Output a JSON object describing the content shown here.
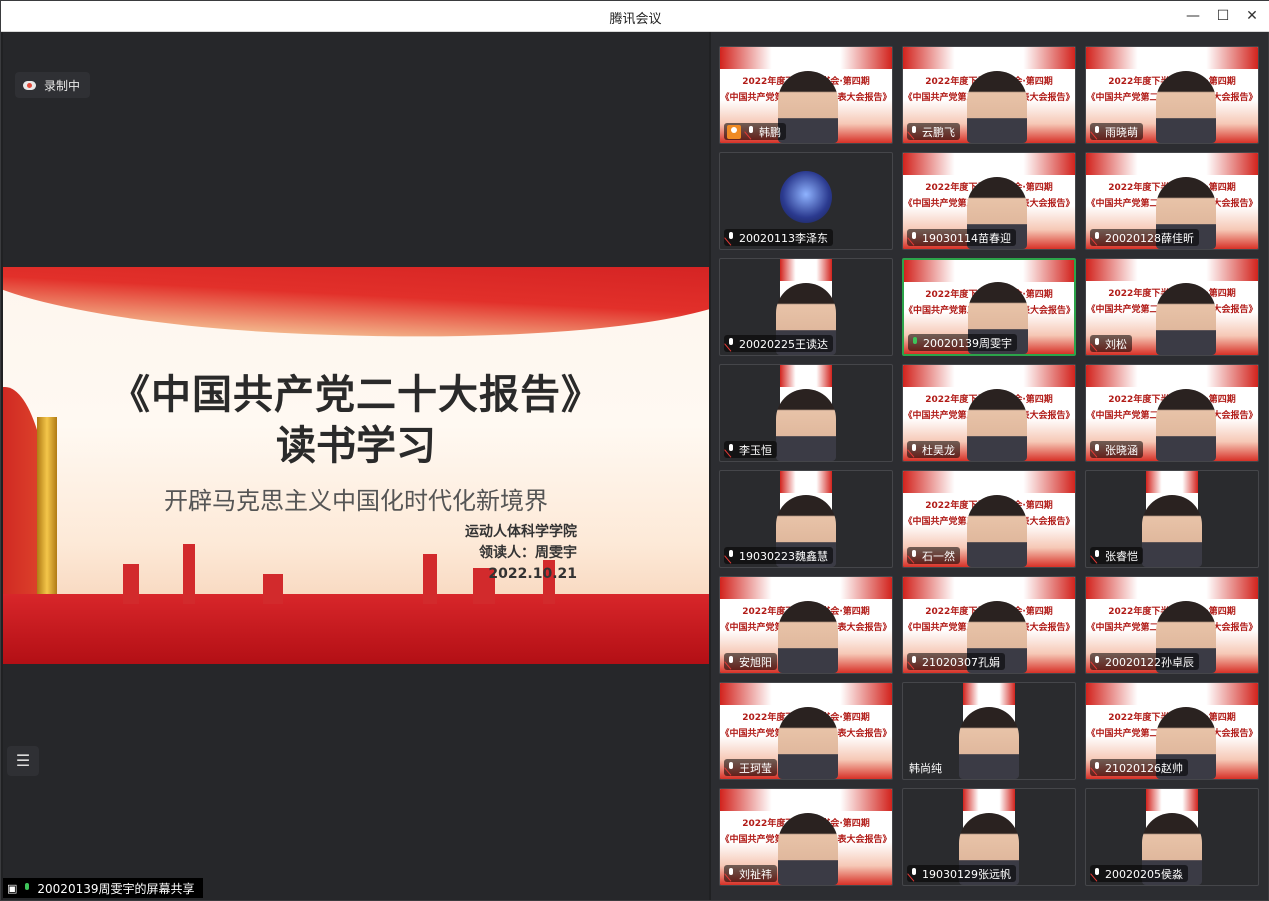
{
  "window": {
    "title": "腾讯会议",
    "minimize": "—",
    "maximize": "☐",
    "close": "✕"
  },
  "recording": {
    "label": "录制中"
  },
  "slide": {
    "title_line1": "《中国共产党二十大报告》",
    "title_line2": "读书学习",
    "subtitle": "开辟马克思主义中国化时代化新境界",
    "college": "运动人体科学学院",
    "leader": "领读人：周雯宇",
    "date": "2022.10.21"
  },
  "share_bar": {
    "label": "20020139周雯宇的屏幕共享"
  },
  "poster_text": {
    "line1": "2022年度下半年读书会·第四期",
    "line2": "《中国共产党第二十次全国代表大会报告》"
  },
  "participants": [
    {
      "name": "韩鹏",
      "kind": "video",
      "mic": "muted",
      "host": true
    },
    {
      "name": "云鹏飞",
      "kind": "video",
      "mic": "muted"
    },
    {
      "name": "雨晓萌",
      "kind": "video",
      "mic": "muted"
    },
    {
      "name": "20020113李泽东",
      "kind": "avatar",
      "mic": "muted"
    },
    {
      "name": "19030114苗春迎",
      "kind": "video",
      "mic": "muted"
    },
    {
      "name": "20020128薛佳昕",
      "kind": "video",
      "mic": "muted"
    },
    {
      "name": "20020225王读达",
      "kind": "narrow",
      "mic": "muted"
    },
    {
      "name": "20020139周雯宇",
      "kind": "video",
      "mic": "on",
      "speaking": true
    },
    {
      "name": "刘松",
      "kind": "video",
      "mic": "muted"
    },
    {
      "name": "李玉恒",
      "kind": "narrow",
      "mic": "muted"
    },
    {
      "name": "杜昊龙",
      "kind": "video",
      "mic": "muted"
    },
    {
      "name": "张晓涵",
      "kind": "video",
      "mic": "muted"
    },
    {
      "name": "19030223魏鑫慧",
      "kind": "narrow",
      "mic": "muted"
    },
    {
      "name": "石一然",
      "kind": "video",
      "mic": "muted"
    },
    {
      "name": "张睿恺",
      "kind": "narrow",
      "mic": "muted"
    },
    {
      "name": "安旭阳",
      "kind": "video",
      "mic": "muted"
    },
    {
      "name": "21020307孔娟",
      "kind": "video",
      "mic": "muted"
    },
    {
      "name": "20020122孙卓辰",
      "kind": "video",
      "mic": "muted"
    },
    {
      "name": "王珂莹",
      "kind": "video",
      "mic": "muted"
    },
    {
      "name": "韩尚纯",
      "kind": "narrow",
      "mic": "none"
    },
    {
      "name": "21020126赵帅",
      "kind": "video",
      "mic": "muted"
    },
    {
      "name": "刘祉祎",
      "kind": "video",
      "mic": "muted"
    },
    {
      "name": "19030129张远帆",
      "kind": "narrow",
      "mic": "muted"
    },
    {
      "name": "20020205侯淼",
      "kind": "narrow",
      "mic": "muted"
    }
  ]
}
